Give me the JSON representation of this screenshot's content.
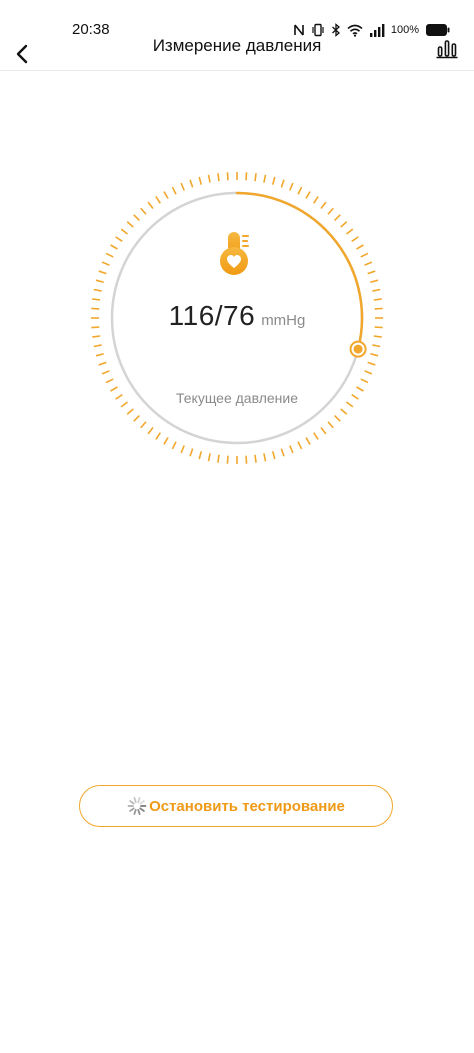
{
  "status_bar": {
    "time": "20:38",
    "battery_percent": "100%",
    "icons": [
      "nfc-icon",
      "vibrate-icon",
      "bluetooth-icon",
      "wifi-icon",
      "signal-icon",
      "battery-icon"
    ]
  },
  "header": {
    "title": "Измерение давления",
    "back_icon": "chevron-left-icon",
    "stats_icon": "bar-chart-icon"
  },
  "measurement": {
    "value": "116/76",
    "unit": "mmHg",
    "caption": "Текущее давление",
    "icon": "thermometer-heart-icon",
    "progress_fraction": 0.29
  },
  "actions": {
    "stop_label": "Остановить тестирование",
    "spinner_icon": "loading-spinner-icon"
  },
  "colors": {
    "accent": "#f1a72c",
    "accent_dark": "#ef9a17",
    "ring_track": "#d4d4d4",
    "text_muted": "#8a8a8a"
  }
}
